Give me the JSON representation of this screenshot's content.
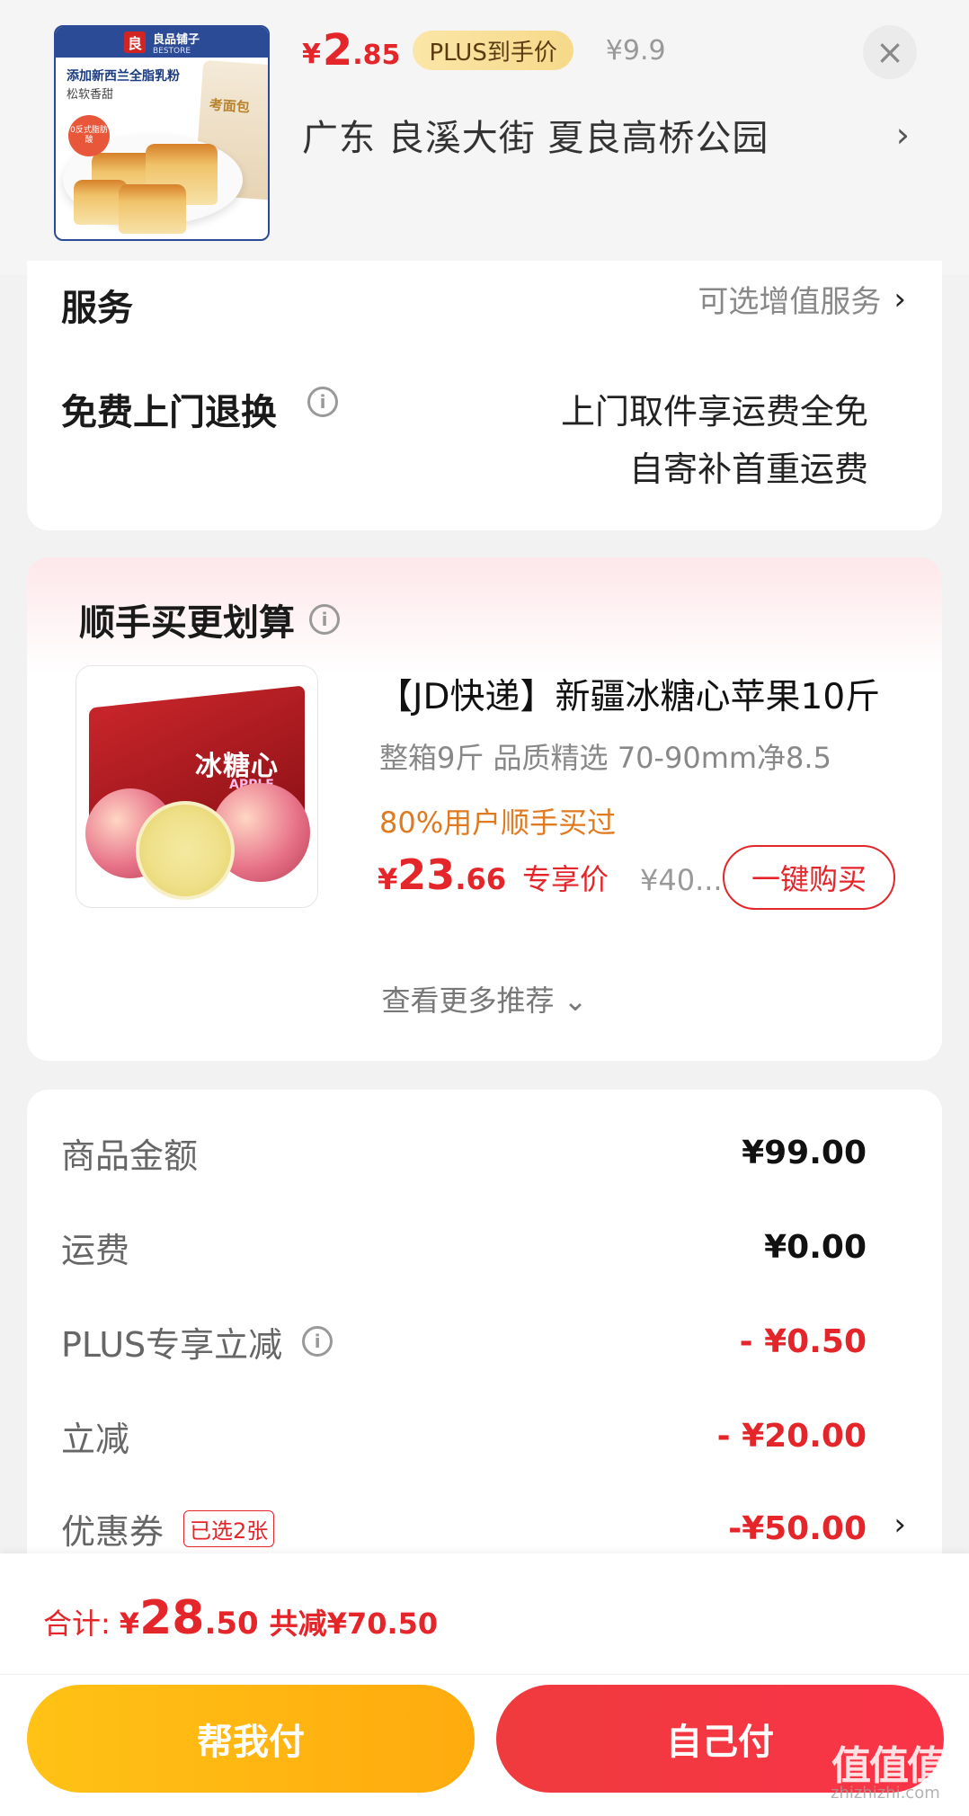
{
  "product": {
    "thumb_brand": "良品铺子",
    "thumb_brand_en": "BESTORE",
    "thumb_logo_char": "良",
    "thumb_line1": "添加新西兰全脂乳粉",
    "thumb_line2": "松软香甜",
    "thumb_badge": "0反式脂肪酸",
    "thumb_bag_text": "考面包",
    "price_currency": "¥",
    "price_int": "2",
    "price_dec": ".85",
    "plus_label": "PLUS到手价",
    "original_price": "¥9.9",
    "close_icon": "×",
    "address": "广东  良溪大街 夏良高桥公园",
    "address_chevron": "›"
  },
  "service": {
    "title": "服务",
    "optional_label": "可选增值服务",
    "optional_chevron": "›",
    "return_title": "免费上门退换",
    "info_icon": "i",
    "return_desc_line1": "上门取件享运费全免",
    "return_desc_line2": "自寄补首重运费"
  },
  "recommend": {
    "title": "顺手买更划算",
    "info_icon": "i",
    "item": {
      "name": "【JD快递】新疆冰糖心苹果10斤",
      "spec": "整箱9斤 品质精选 70-90mm净8.5",
      "social": "80%用户顺手买过",
      "price_currency": "¥",
      "price_int": "23",
      "price_dec": ".66",
      "price_tag": "专享价",
      "original_price": "¥40...",
      "buy_label": "一键购买",
      "image_box_text": "冰糖心",
      "image_box_en": "APPLE"
    },
    "more_label": "查看更多推荐 ⌄"
  },
  "amounts": {
    "rows": [
      {
        "label": "商品金额",
        "value": "¥99.00"
      },
      {
        "label": "运费",
        "value": "¥0.00"
      },
      {
        "label": "PLUS专享立减",
        "value": "- ¥0.50"
      },
      {
        "label": "立减",
        "value": "- ¥20.00"
      },
      {
        "label": "优惠券",
        "value": "-¥50.00",
        "tag": "已选2张"
      }
    ],
    "info_icon": "i",
    "coupon_chevron": "›"
  },
  "footer": {
    "total_label": "合计:",
    "total_currency": "¥",
    "total_int": "28",
    "total_dec": ".50",
    "total_saved": "共减¥70.50",
    "help_pay_label": "帮我付",
    "self_pay_label": "自己付",
    "watermark": "值值值",
    "watermark_sub": "zhizhizhi.com"
  },
  "colors": {
    "accent_red": "#e4262b",
    "accent_yellow": "#ffc215",
    "social_orange": "#e07a20"
  }
}
